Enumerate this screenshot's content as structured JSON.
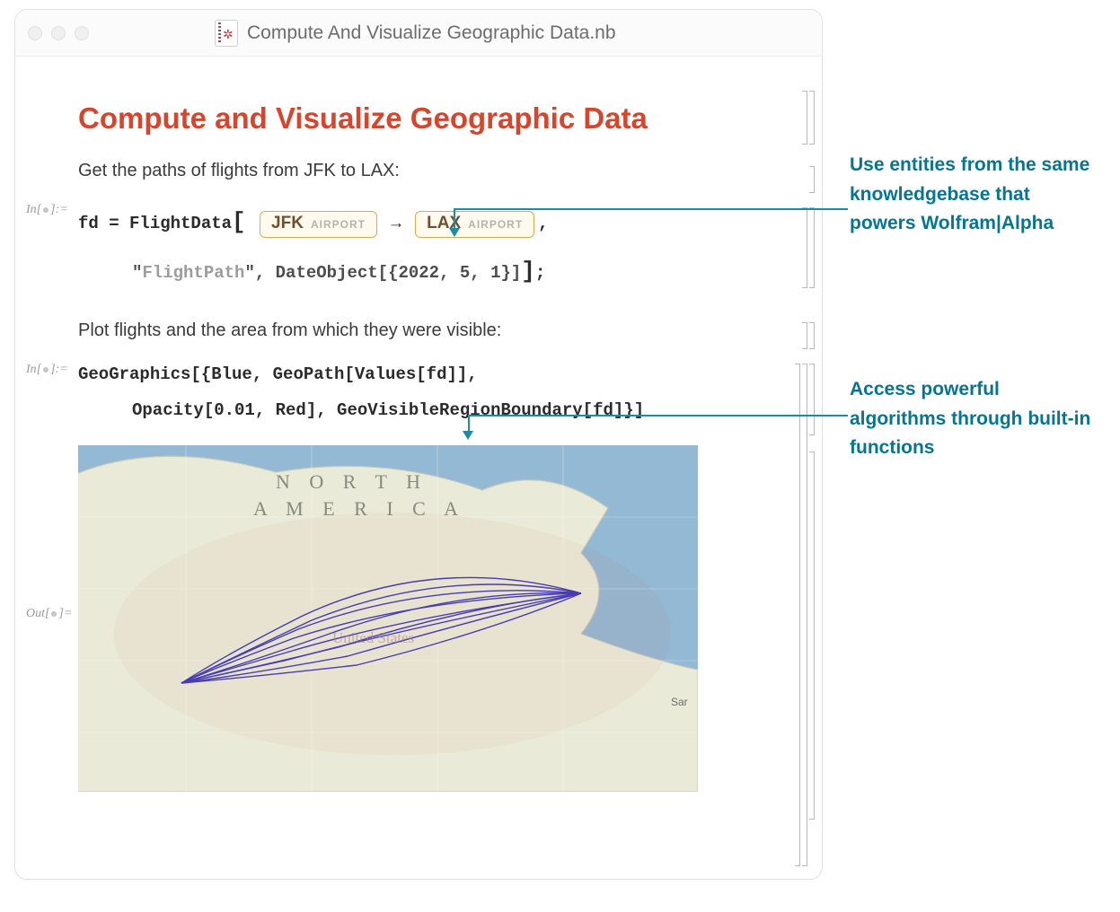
{
  "window_title": "Compute And Visualize Geographic Data.nb",
  "heading": "Compute and Visualize Geographic Data",
  "text1": "Get the paths of flights from JFK to LAX:",
  "text2": "Plot flights and the area from which they were visible:",
  "io_labels": {
    "in_prefix": "In[",
    "in_suffix": "]:=",
    "out_prefix": "Out[",
    "out_suffix": "]="
  },
  "code1": {
    "lhs": "fd = FlightData",
    "lbracket": "[",
    "entity1": {
      "code": "JFK",
      "kind": "AIRPORT"
    },
    "arrow": "→",
    "entity2": {
      "code": "LAX",
      "kind": "AIRPORT"
    },
    "comma": ",",
    "line2_a": "\"",
    "line2_string": "FlightPath",
    "line2_b": "\", DateObject[{2022, 5, 1}]",
    "rbracket": "]",
    "semi": ";"
  },
  "code2": {
    "line1": "GeoGraphics[{Blue, GeoPath[Values[fd]],",
    "line2": "Opacity[0.01, Red], GeoVisibleRegionBoundary[fd]}]"
  },
  "map": {
    "label_na_1": "N O R T H",
    "label_na_2": "A M E R I C A",
    "label_us": "United States",
    "label_san": "Sar"
  },
  "annotations": {
    "a1": "Use entities from the same knowledgebase that powers Wolfram|Alpha",
    "a2": "Access powerful algorithms through built-in functions"
  }
}
